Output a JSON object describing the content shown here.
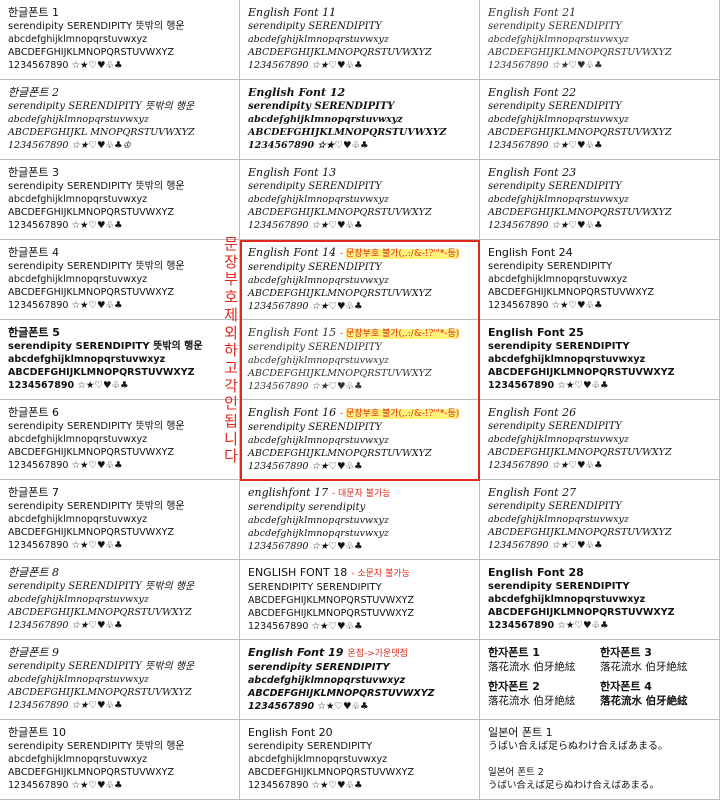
{
  "colors": {
    "border": "#bdbdbd",
    "note_red": "#e0281e",
    "highlight": "#fff27a"
  },
  "vertical_note": [
    "문",
    "장",
    "부",
    "호",
    "제",
    "외",
    "하",
    "고",
    "각",
    "인",
    "됩",
    "니",
    "다"
  ],
  "cells": [
    {
      "col": 0,
      "row": 0,
      "style": "",
      "lines": [
        "한글폰트 1",
        "serendipity SERENDIPITY 뜻밖의 행운",
        "abcdefghijklmnopqrstuvwxyz",
        "ABCDEFGHIJKLMNOPQRSTUVWXYZ",
        "1234567890 ☆★♡♥♧♣"
      ]
    },
    {
      "col": 0,
      "row": 1,
      "style": "script",
      "lines": [
        "한글폰트 2",
        "serendipity SERENDIPITY 뜻밖의 행운",
        "abcdefghijklmnopqrstuvwxyz",
        "ABCDEFGHIJKL MNOPQRSTUVWXYZ",
        "1234567890 ☆★♡♥♧♣♔"
      ]
    },
    {
      "col": 0,
      "row": 2,
      "style": "",
      "lines": [
        "한글폰트 3",
        "serendipity SERENDIPITY 뜻밖의 행운",
        "abcdefghijklmnopqrstuvwxyz",
        "ABCDEFGHIJKLMNOPQRSTUVWXYZ",
        "1234567890 ☆★♡♥♧♣"
      ]
    },
    {
      "col": 0,
      "row": 3,
      "style": "",
      "lines": [
        "한글폰트 4",
        "serendipity SERENDIPITY 뜻밖의 행운",
        "abcdefghijklmnopqrstuvwxyz",
        "ABCDEFGHIJKLMNOPQRSTUVWXYZ",
        "1234567890 ☆★♡♥♧♣"
      ]
    },
    {
      "col": 0,
      "row": 4,
      "style": "bold",
      "lines": [
        "한글폰트 5",
        "serendipity SERENDIPITY 뜻밖의 행운",
        "abcdefghijklmnopqrstuvwxyz",
        "ABCDEFGHIJKLMNOPQRSTUVWXYZ",
        "1234567890 ☆★♡♥♧♣"
      ]
    },
    {
      "col": 0,
      "row": 5,
      "style": "",
      "lines": [
        "한글폰트 6",
        "serendipity SERENDIPITY 뜻밖의 행운",
        "abcdefghijklmnopqrstuvwxyz",
        "ABCDEFGHIJKLMNOPQRSTUVWXYZ",
        "1234567890 ☆★♡♥♧♣"
      ]
    },
    {
      "col": 0,
      "row": 6,
      "style": "",
      "lines": [
        "한글폰트 7",
        "serendipity SERENDIPITY 뜻밖의 행운",
        "abcdefghijklmnopqrstuvwxyz",
        "ABCDEFGHIJKLMNOPQRSTUVWXYZ",
        "1234567890 ☆★♡♥♧♣"
      ]
    },
    {
      "col": 0,
      "row": 7,
      "style": "script",
      "lines": [
        "한글폰트 8",
        "serendipity SERENDIPITY 뜻밖의 행운",
        "abcdefghijklmnopqrstuvwxyz",
        "ABCDEFGHIJKLMNOPQRSTUVWXYZ",
        "1234567890 ☆★♡♥♧♣"
      ]
    },
    {
      "col": 0,
      "row": 8,
      "style": "script",
      "lines": [
        "한글폰트 9",
        "serendipity SERENDIPITY 뜻밖의 행운",
        "abcdefghijklmnopqrstuvwxyz",
        "ABCDEFGHIJKLMNOPQRSTUVWXYZ",
        "1234567890 ☆★♡♥♧♣"
      ]
    },
    {
      "col": 0,
      "row": 9,
      "style": "",
      "lines": [
        "한글폰트 10",
        "serendipity SERENDIPITY 뜻밖의 행운",
        "abcdefghijklmnopqrstuvwxyz",
        "ABCDEFGHIJKLMNOPQRSTUVWXYZ",
        "1234567890 ☆★♡♥♧♣"
      ]
    },
    {
      "col": 1,
      "row": 0,
      "style": "script",
      "lines": [
        "English Font 11",
        "serendipity SERENDIPITY",
        "abcdefghijklmnopqrstuvwxyz",
        "ABCDEFGHIJKLMNOPQRSTUVWXYZ",
        "1234567890 ☆★♡♥♧♣"
      ]
    },
    {
      "col": 1,
      "row": 1,
      "style": "script bold",
      "lines": [
        "English Font 12",
        "serendipity SERENDIPITY",
        "abcdefghijklmnopqrstuvwxyz",
        "ABCDEFGHIJKLMNOPQRSTUVWXYZ",
        "1234567890 ☆★♡♥♧♣"
      ]
    },
    {
      "col": 1,
      "row": 2,
      "style": "script",
      "lines": [
        "English Font 13",
        "serendipity SERENDIPITY",
        "abcdefghijklmnopqrstuvwxyz",
        "ABCDEFGHIJKLMNOPQRSTUVWXYZ",
        "1234567890 ☆★♡♥♧♣"
      ]
    },
    {
      "col": 1,
      "row": 3,
      "style": "script",
      "note_prefix": "- ",
      "note": "문장부호 불가(,.:/&-!?'\"*-등)",
      "lines": [
        "English Font 14",
        "serendipity SERENDIPITY",
        "abcdefghijklmnopqrstuvwxyz",
        "ABCDEFGHIJKLMNOPQRSTUVWXYZ",
        "1234567890 ☆★♡♥♧♣"
      ]
    },
    {
      "col": 1,
      "row": 4,
      "style": "script light",
      "note_prefix": "- ",
      "note": "문장부호 불가(,.:/&-!?'\"*-등)",
      "lines": [
        "English Font 15",
        "serendipity SERENDIPITY",
        "abcdefghijklmnopqrstuvwxyz",
        "ABCDEFGHIJKLMNOPQRSTUVWXYZ",
        "1234567890 ☆★♡♥♧♣"
      ]
    },
    {
      "col": 1,
      "row": 5,
      "style": "script",
      "note_prefix": "- ",
      "note": "문장부호 불가(,.:/&-!?'\"*-등)",
      "lines": [
        "English Font 16",
        "serendipity SERENDIPITY",
        "abcdefghijklmnopqrstuvwxyz",
        "ABCDEFGHIJKLMNOPQRSTUVWXYZ",
        "1234567890 ☆★♡♥♧♣"
      ]
    },
    {
      "col": 1,
      "row": 6,
      "style": "script",
      "note": "- 대문자 불가능",
      "lines": [
        "englishfont 17",
        "serendipity serendipity",
        "abcdefghijklmnopqrstuvwxyz",
        "abcdefghijklmnopqrstuvwxyz",
        "1234567890 ☆★♡♥♧♣"
      ]
    },
    {
      "col": 1,
      "row": 7,
      "style": "",
      "note": "- 소문자 불가능",
      "lines": [
        "ENGLISH FONT 18",
        "SERENDIPITY SERENDIPITY",
        "ABCDEFGHIJKLMNOPQRSTUVWXYZ",
        "ABCDEFGHIJKLMNOPQRSTUVWXYZ",
        "1234567890 ☆★♡♥♧♣"
      ]
    },
    {
      "col": 1,
      "row": 8,
      "style": "bold italic",
      "note": "온점->가운뎃점",
      "lines": [
        "English Font 19",
        "serendipity SERENDIPITY",
        "abcdefghijklmnopqrstuvwxyz",
        "ABCDEFGHIJKLMNOPQRSTUVWXYZ",
        "1234567890 ☆★♡♥♧♣"
      ]
    },
    {
      "col": 1,
      "row": 9,
      "style": "",
      "lines": [
        "English Font 20",
        "serendipity SERENDIPITY",
        "abcdefghijklmnopqrstuvwxyz",
        "ABCDEFGHIJKLMNOPQRSTUVWXYZ",
        "1234567890 ☆★♡♥♧♣"
      ]
    },
    {
      "col": 2,
      "row": 0,
      "style": "script light",
      "lines": [
        "English Font 21",
        "serendipity SERENDIPITY",
        "abcdefghijklmnopqrstuvwxyz",
        "ABCDEFGHIJKLMNOPQRSTUVWXYZ",
        "1234567890 ☆★♡♥♧♣"
      ]
    },
    {
      "col": 2,
      "row": 1,
      "style": "script",
      "lines": [
        "English Font 22",
        "serendipity SERENDIPITY",
        "abcdefghijklmnopqrstuvwxyz",
        "ABCDEFGHIJKLMNOPQRSTUVWXYZ",
        "1234567890 ☆★♡♥♧♣"
      ]
    },
    {
      "col": 2,
      "row": 2,
      "style": "script",
      "lines": [
        "English Font 23",
        "serendipity SERENDIPITY",
        "abcdefghijklmnopqrstuvwxyz",
        "ABCDEFGHIJKLMNOPQRSTUVWXYZ",
        "1234567890 ☆★♡♥♧♣"
      ]
    },
    {
      "col": 2,
      "row": 3,
      "style": "",
      "lines": [
        "English Font 24",
        "serendipity SERENDIPITY",
        "abcdefghijklmnopqrstuvwxyz",
        "ABCDEFGHIJKLMNOPQRSTUVWXYZ",
        "1234567890 ☆★♡♥♧♣"
      ]
    },
    {
      "col": 2,
      "row": 4,
      "style": "bold",
      "lines": [
        "English Font 25",
        "serendipity SERENDIPITY",
        "abcdefghijklmnopqrstuvwxyz",
        "ABCDEFGHIJKLMNOPQRSTUVWXYZ",
        "1234567890 ☆★♡♥♧♣"
      ]
    },
    {
      "col": 2,
      "row": 5,
      "style": "script",
      "lines": [
        "English Font 26",
        "serendipity SERENDIPITY",
        "abcdefghijklmnopqrstuvwxyz",
        "ABCDEFGHIJKLMNOPQRSTUVWXYZ",
        "1234567890 ☆★♡♥♧♣"
      ]
    },
    {
      "col": 2,
      "row": 6,
      "style": "script",
      "lines": [
        "English Font 27",
        "serendipity SERENDIPITY",
        "abcdefghijklmnopqrstuvwxyz",
        "ABCDEFGHIJKLMNOPQRSTUVWXYZ",
        "1234567890 ☆★♡♥♧♣"
      ]
    },
    {
      "col": 2,
      "row": 7,
      "style": "bold",
      "lines": [
        "English Font 28",
        "serendipity SERENDIPITY",
        "abcdefghijklmnopqrstuvwxyz",
        "ABCDEFGHIJKLMNOPQRSTUVWXYZ",
        "1234567890 ☆★♡♥♧♣"
      ]
    },
    {
      "col": 2,
      "row": 8,
      "style": "kanji",
      "kanji": [
        {
          "title": "한자폰트 1",
          "text": "落花流水 伯牙絶絃"
        },
        {
          "title": "한자폰트 3",
          "text": "落花流水 伯牙絶絃"
        },
        {
          "title": "한자폰트 2",
          "text": "落花流水 伯牙絶絃"
        },
        {
          "title": "한자폰트 4",
          "text": "落花流水 伯牙絶絃"
        }
      ]
    },
    {
      "col": 2,
      "row": 9,
      "style": "",
      "lines": [
        "일본어 폰트 1",
        "うばい合えば足らぬわけ合えばあまる。",
        "",
        "일본어 폰트 2",
        "うばい合えば足らぬわけ合えばあまる。"
      ]
    }
  ]
}
